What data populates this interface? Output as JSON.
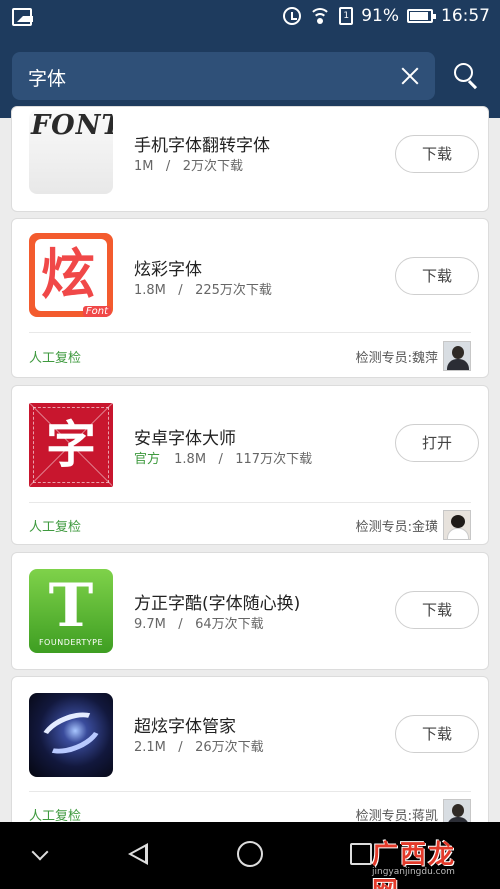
{
  "status_bar": {
    "battery": "91%",
    "time": "16:57",
    "sim_label": "1"
  },
  "search": {
    "query": "字体"
  },
  "apps": [
    {
      "name": "手机字体翻转字体",
      "size": "1M",
      "downloads": "2万次下载",
      "button": "下载",
      "icon": "font-app-icon",
      "icon_text": "FONT"
    },
    {
      "name": "炫彩字体",
      "size": "1.8M",
      "downloads": "225万次下载",
      "button": "下载",
      "icon": "xuancai-app-icon",
      "icon_text": "炫",
      "icon_tag": "Font",
      "review": "人工复检",
      "tester": "检测专员:魏萍"
    },
    {
      "name": "安卓字体大师",
      "official": "官方",
      "size": "1.8M",
      "downloads": "117万次下载",
      "button": "打开",
      "icon": "zi-app-icon",
      "icon_text": "字",
      "review": "人工复检",
      "tester": "检测专员:金璜"
    },
    {
      "name": "方正字酷(字体随心换)",
      "size": "9.7M",
      "downloads": "64万次下载",
      "button": "下载",
      "icon": "founder-app-icon",
      "icon_text": "T",
      "icon_brand": "FOUNDERTYPE"
    },
    {
      "name": "超炫字体管家",
      "size": "2.1M",
      "downloads": "26万次下载",
      "button": "下载",
      "icon": "galaxy-app-icon",
      "review": "人工复检",
      "tester": "检测专员:蒋凯"
    }
  ],
  "nav_bar": {
    "icons": [
      "chevron-down-icon",
      "back-icon",
      "home-icon",
      "recent-apps-icon"
    ]
  },
  "watermark": {
    "logo": "广西龙网",
    "url": "jingyanjingdu.com"
  },
  "colors": {
    "header": "#1e3b5e",
    "search_box": "#2f5078",
    "official_green": "#3f9a3f",
    "icon_red": "#c8162e",
    "icon_green": "#3e9e22"
  }
}
